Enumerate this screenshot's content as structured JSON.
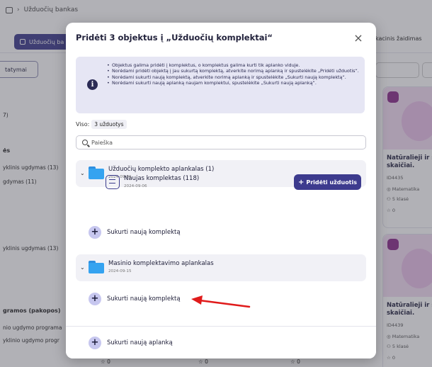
{
  "background": {
    "breadcrumb": "Užduočių bankas",
    "tab_tasks": "Užduočių ba",
    "tab_games": "kacinis žaidimas",
    "filter_select": "tatymai",
    "left_texts": [
      "7)",
      "ės",
      "yklinis ugdymas (13)",
      "gdymas (11)",
      "yklinis ugdymas (13)",
      "gramos (pakopos)",
      "nio ugdymo programa",
      "yklinio ugdymo progr"
    ],
    "cards": [
      {
        "title_1": "Natūralieji ir s",
        "title_2": "skaičiai.",
        "id": "ID4435",
        "subject": "Matematika",
        "grade": "5 klasė",
        "stars": "0"
      },
      {
        "title_1": "Natūralieji ir s",
        "title_2": "skaičiai.",
        "id": "ID4439",
        "subject": "Matematika",
        "grade": "5 klasė",
        "stars": "0"
      }
    ],
    "bottom_stars": [
      "0",
      "0",
      "0"
    ]
  },
  "modal": {
    "title": "Pridėti 3 objektus į „Užduočių komplektai“",
    "close": "×",
    "info_icon": "i",
    "info_items": [
      "Objektus galima pridėti į komplektus, o komplektus galima kurti tik aplanko viduje.",
      "Norėdami pridėti objektą į jau sukurtą komplektą, atverkite norimą aplanką ir spustelėkite „Pridėti užduotis“.",
      "Norėdami sukurti naują komplektą, atverkite norimą aplanką ir spustelėkite „Sukurti naują komplektą“.",
      "Norėdami sukurti naują aplanką naujam komplektui, spustelėkite „Sukurti naują aplanką“."
    ],
    "count_label": "Viso:",
    "count_value": "3 užduotys",
    "search_placeholder": "Paieška",
    "folders": [
      {
        "name": "Užduočių komplekto aplankalas (1)",
        "date": "2024-09-06"
      },
      {
        "name": "Masinio komplektavimo aplankalas",
        "date": "2024-09-15"
      }
    ],
    "kit": {
      "name": "Naujas komplektas (118)",
      "date": "2024-09-06",
      "add_button": "Pridėti užduotis"
    },
    "create_kit_label": "Sukurti naują komplektą",
    "create_folder_label": "Sukurti naują aplanką"
  },
  "colors": {
    "primary": "#3d3b8e",
    "annotation_arrow": "#e01b1b",
    "folder": "#35a3f0"
  },
  "icons": [
    "home-icon",
    "info-icon",
    "search-icon",
    "folder-icon",
    "kit-icon",
    "plus-icon",
    "close-icon",
    "chevron-down-icon"
  ]
}
